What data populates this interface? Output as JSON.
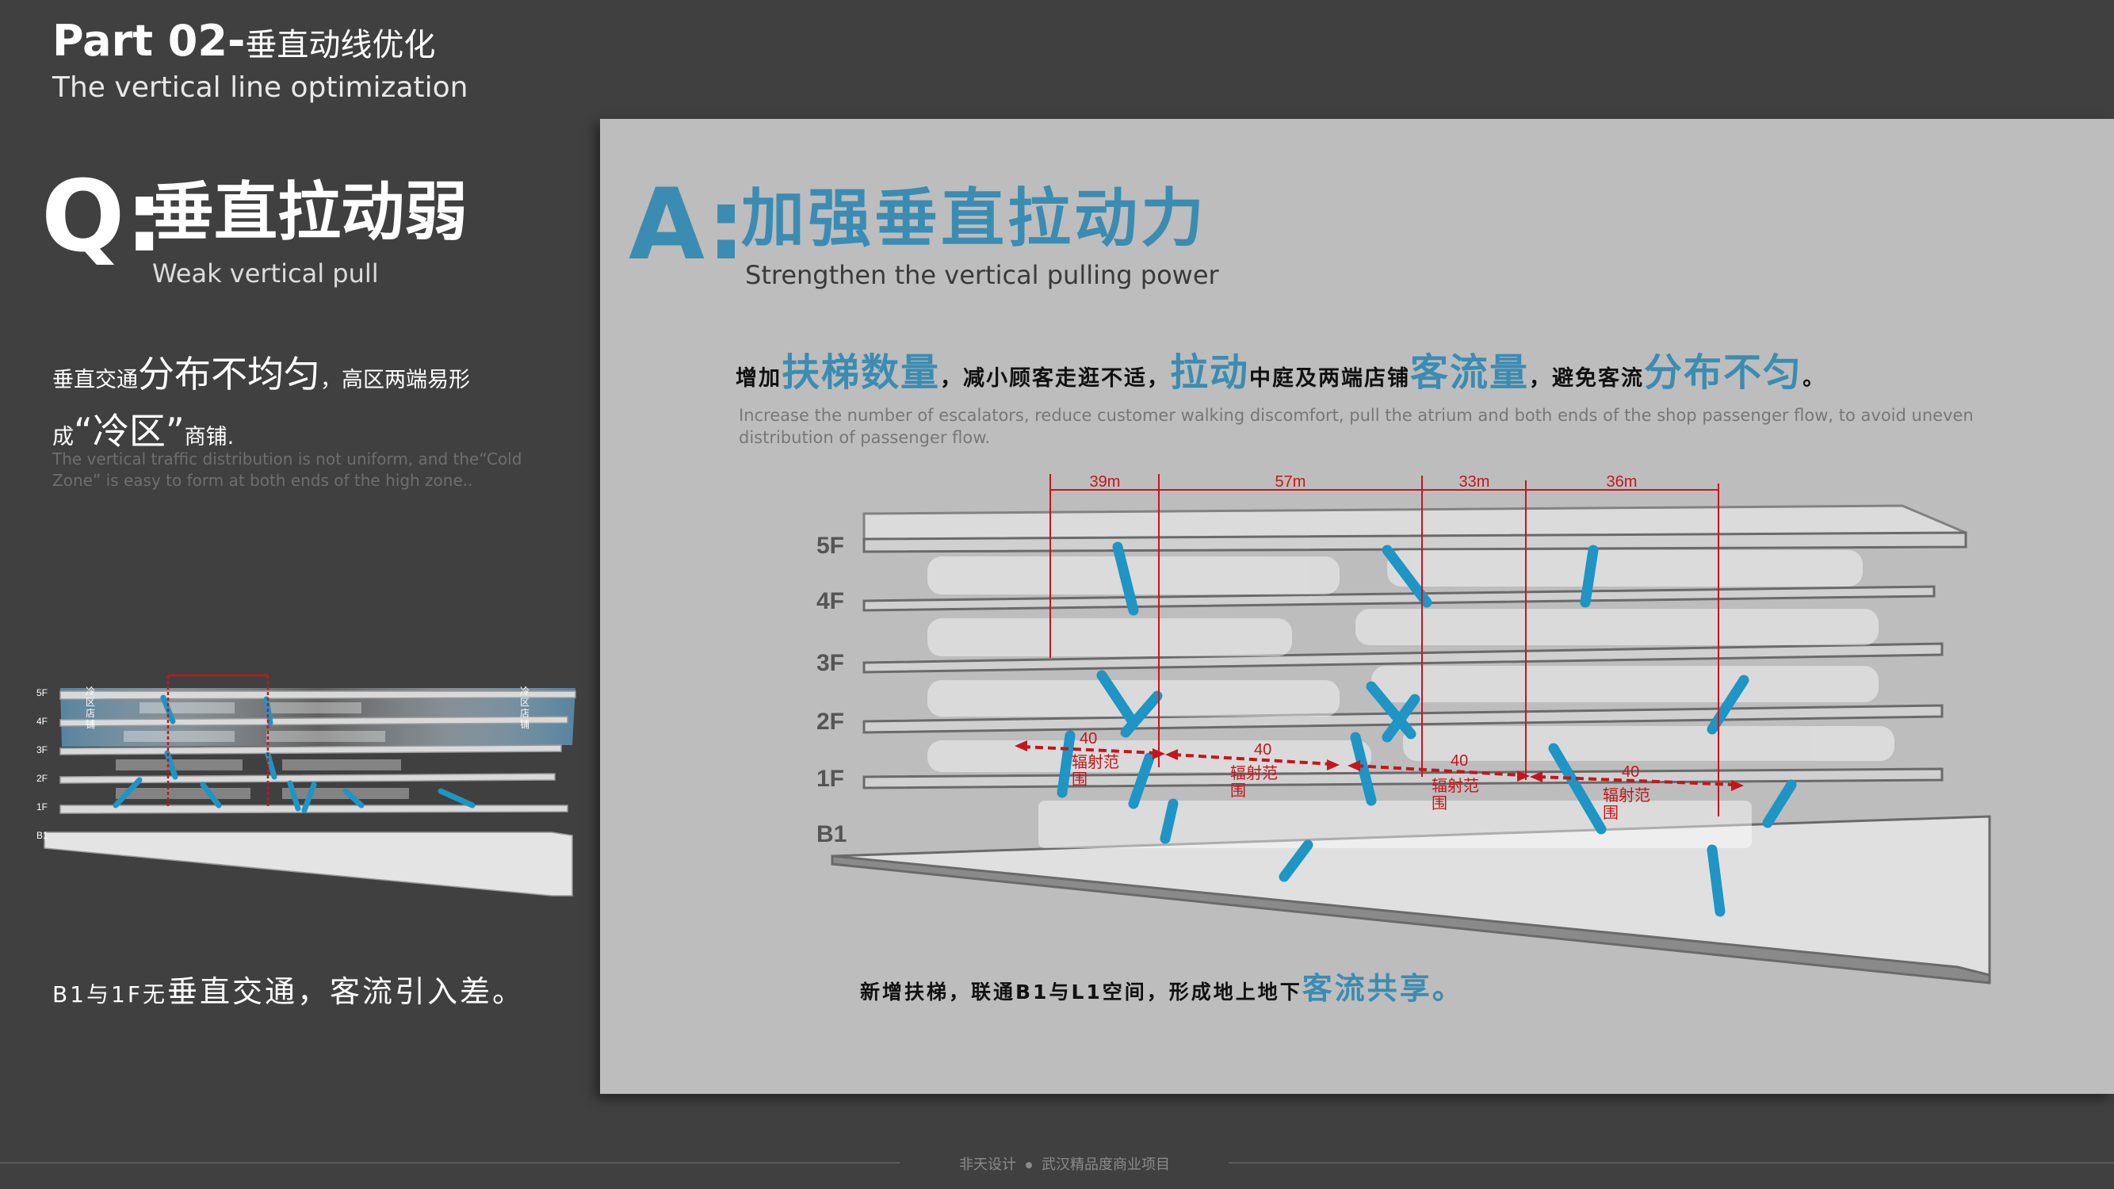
{
  "header": {
    "title_en": "Part 02-",
    "title_cn": "垂直动线优化",
    "subtitle": "The vertical line optimization"
  },
  "question": {
    "letter": "Q:",
    "title": "垂直拉动弱",
    "subtitle": "Weak vertical pull",
    "line1": {
      "a": "垂直交通",
      "b": "分布不均匀",
      "c": "，高区两端易形"
    },
    "line2": {
      "a": "成",
      "b": "“冷区”",
      "c": "商铺."
    },
    "desc_en": "The vertical traffic distribution is not uniform, and the“Cold Zone” is easy to form at both ends of the high zone..",
    "diagram": {
      "floors": [
        "5F",
        "4F",
        "3F",
        "2F",
        "1F",
        "B1"
      ],
      "cold_zone_label": "冷区店铺"
    },
    "bottom": {
      "a": "B1与1F无",
      "b": "垂直交通，客流引入差。"
    }
  },
  "answer": {
    "letter": "A:",
    "title": "加强垂直拉动力",
    "subtitle": "Strengthen the vertical pulling power",
    "line": {
      "p1": "增加",
      "b1": "扶梯数量",
      "p2": "，减小顾客走逛不适，",
      "b2": "拉动",
      "p3": "中庭及两端店铺",
      "b3": "客流量",
      "p4": "，避免客流",
      "b4": "分布不匀",
      "p5": "。"
    },
    "desc_en": "Increase the number of escalators, reduce customer walking discomfort, pull the atrium and both ends of the shop passenger flow, to avoid uneven distribution of passenger flow.",
    "diagram": {
      "floors": [
        "5F",
        "4F",
        "3F",
        "2F",
        "1F",
        "B1"
      ],
      "spacings": [
        "39m",
        "57m",
        "33m",
        "36m"
      ],
      "radius_value": "40",
      "radius_label": "辐射范围"
    },
    "bottom": {
      "a": "新增扶梯，联通B1与L1空间，形成地上地下",
      "b": "客流共享。"
    }
  },
  "footer": {
    "brand": "非天设计",
    "project": "武汉精品度商业项目"
  },
  "colors": {
    "accent_blue": "#3b8cb2",
    "escalator_blue": "#1e95c4",
    "dimension_red": "#c4161c",
    "background": "#404040",
    "panel": "#bdbdbd"
  }
}
